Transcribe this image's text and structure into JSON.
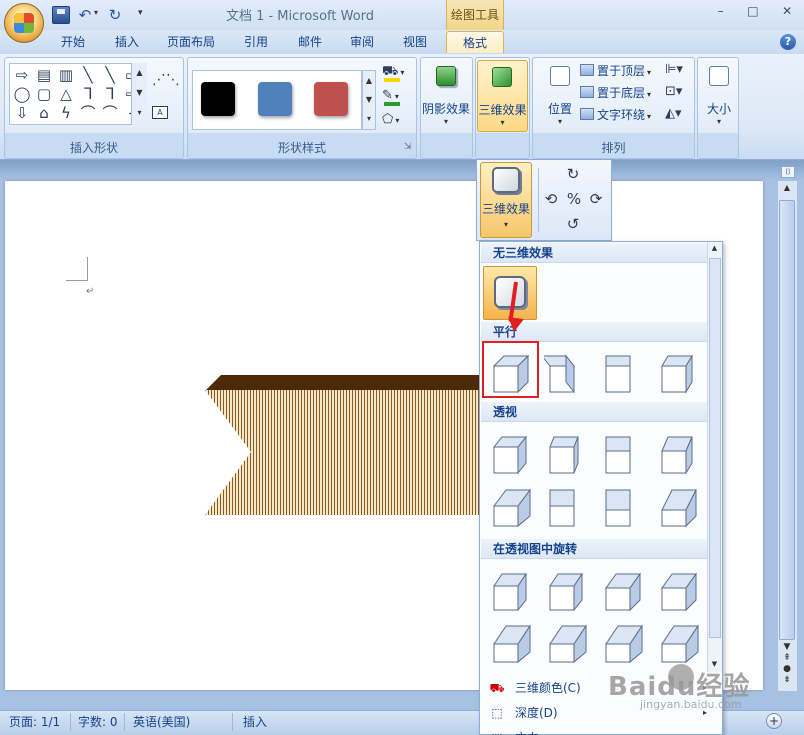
{
  "window": {
    "title": "文档 1 - Microsoft Word",
    "context_tab_group": "绘图工具",
    "controls": [
      "–",
      "□",
      "✕"
    ]
  },
  "quick_access": {
    "undo": "↶",
    "redo": "↻",
    "dropdown": "▾"
  },
  "tabs": [
    {
      "label": "开始"
    },
    {
      "label": "插入"
    },
    {
      "label": "页面布局"
    },
    {
      "label": "引用"
    },
    {
      "label": "邮件"
    },
    {
      "label": "审阅"
    },
    {
      "label": "视图"
    },
    {
      "label": "格式",
      "active": true
    }
  ],
  "help": "?",
  "ribbon": {
    "shapes_group": {
      "label": "插入形状",
      "gallery": [
        "⇨",
        "▤",
        "▥",
        "╲",
        "╲",
        "▭",
        "◯",
        "▢",
        "△",
        "ᒣ",
        "ᒣ",
        "⇨",
        "⇩",
        "⌂",
        "ϟ",
        "⌒",
        "⌒",
        "{"
      ]
    },
    "styles_group": {
      "label": "形状样式",
      "swatch_colors": [
        "#000000",
        "#4f81bd",
        "#c0504d"
      ],
      "fill_color": "#ffd700",
      "outline_color": "#2e9a2e"
    },
    "shadow_button": "阴影效果",
    "three_d_button": "三维效果",
    "arrange_group": {
      "label": "排列",
      "position_button": "位置",
      "bring_front": "置于顶层",
      "send_back": "置于底层",
      "text_wrap": "文字环绕"
    },
    "size_button": "大小"
  },
  "three_d_popup": {
    "label": "三维效果",
    "tilt_up": "↻",
    "tilt_left": "⟲",
    "tilt_toggle": "%",
    "tilt_right": "⟳",
    "tilt_down": "↺"
  },
  "dropdown": {
    "no_effect_header": "无三维效果",
    "parallel_header": "平行",
    "perspective_header": "透视",
    "rotate_header": "在透视图中旋转",
    "color_item": "三维颜色(C)",
    "depth_item": "深度(D)",
    "direction_item": "方向"
  },
  "statusbar": {
    "page": "页面: 1/1",
    "words": "字数: 0",
    "language": "英语(美国)",
    "mode": "插入",
    "zoom_plus": "+"
  },
  "document": {
    "banner_top_color": "#4e2a08",
    "banner_stripe_color": "#8a5a23",
    "paragraph_mark": "↵"
  },
  "watermark": {
    "brand": "Baidu经验",
    "url": "jingyan.baidu.com"
  }
}
